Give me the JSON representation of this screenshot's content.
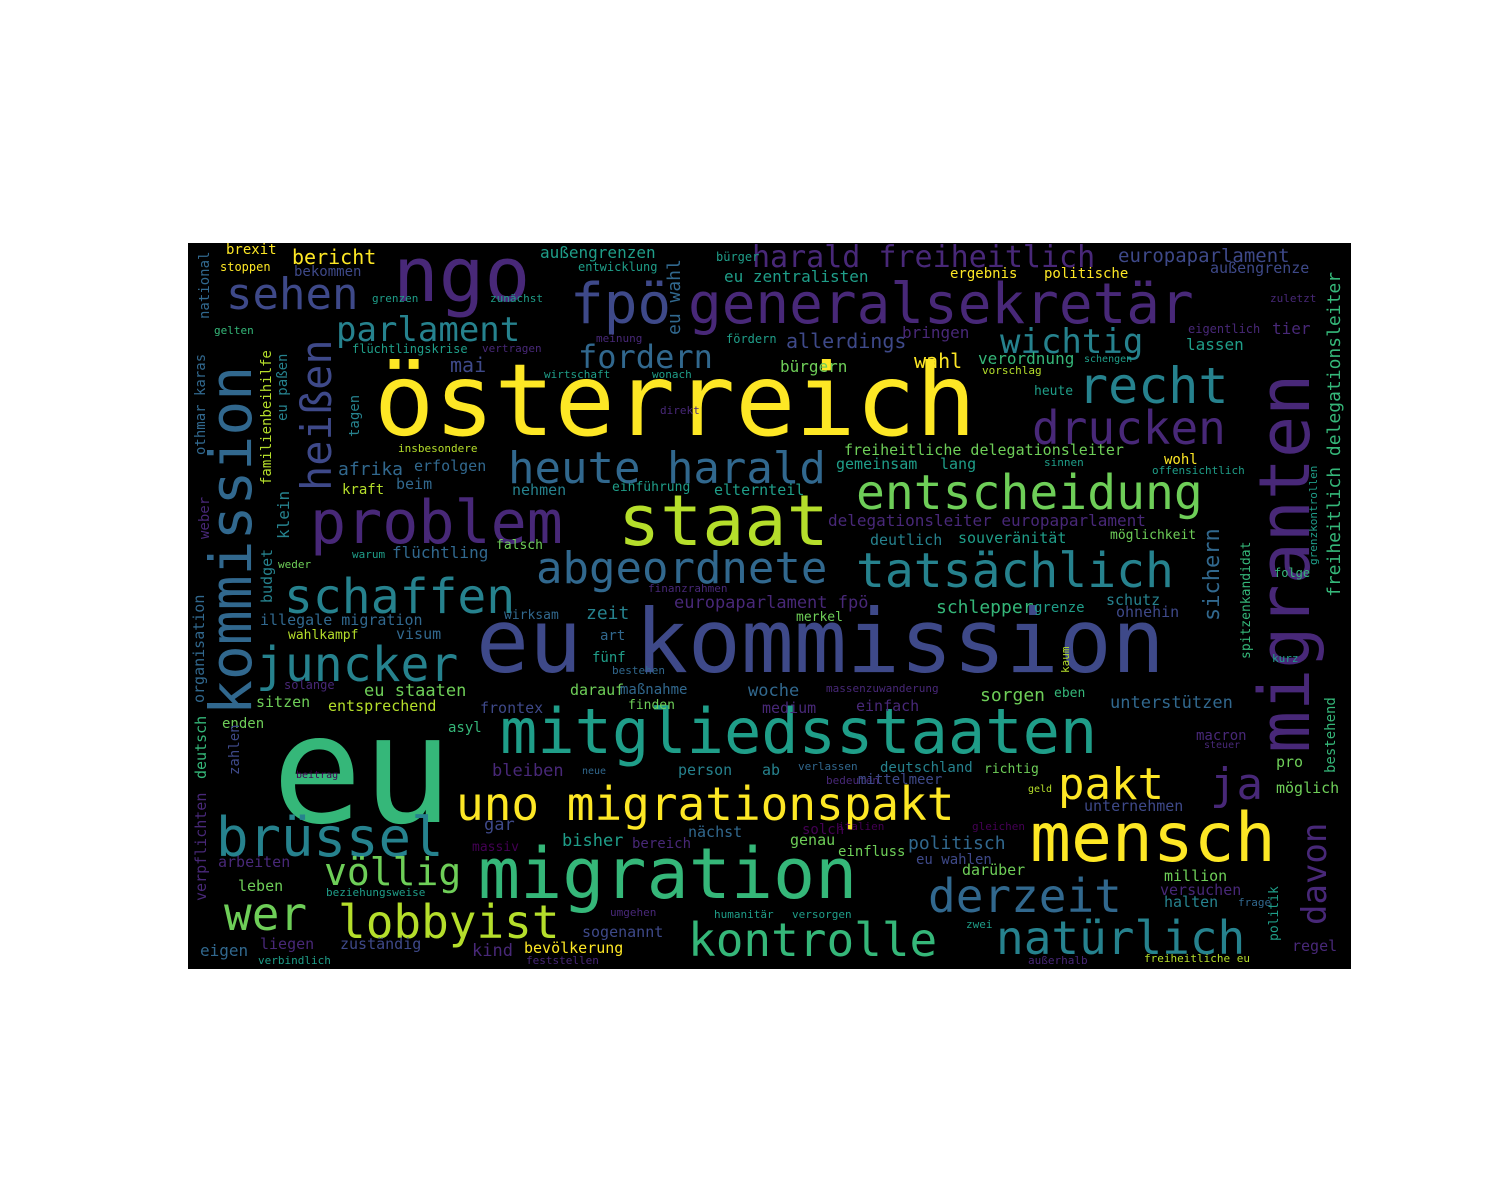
{
  "palette": {
    "yellow": "#fde725",
    "lime": "#b5de2b",
    "green": "#6ece58",
    "mint": "#35b779",
    "teal": "#1f9e89",
    "blue": "#26828e",
    "slate": "#31688e",
    "indigo": "#3e4989",
    "violet": "#482878",
    "purple": "#440154"
  },
  "words": [
    {
      "text": "österreich",
      "color": "yellow"
    },
    {
      "text": "eu kommission",
      "color": "indigo"
    },
    {
      "text": "eu",
      "color": "mint"
    },
    {
      "text": "migranten",
      "color": "violet"
    },
    {
      "text": "kommission",
      "color": "slate"
    },
    {
      "text": "staat",
      "color": "lime"
    },
    {
      "text": "migration",
      "color": "mint"
    },
    {
      "text": "mensch",
      "color": "yellow"
    },
    {
      "text": "ngo",
      "color": "violet"
    },
    {
      "text": "problem",
      "color": "violet"
    },
    {
      "text": "mitgliedsstaaten",
      "color": "teal"
    },
    {
      "text": "generalsekretär",
      "color": "violet"
    },
    {
      "text": "fpö",
      "color": "indigo"
    },
    {
      "text": "entscheidung",
      "color": "green"
    },
    {
      "text": "uno migrationspakt",
      "color": "yellow"
    },
    {
      "text": "brüssel",
      "color": "blue"
    },
    {
      "text": "tatsächlich",
      "color": "blue"
    },
    {
      "text": "abgeordnete",
      "color": "slate"
    },
    {
      "text": "heute harald",
      "color": "slate"
    },
    {
      "text": "schaffen",
      "color": "blue"
    },
    {
      "text": "juncker",
      "color": "blue"
    },
    {
      "text": "kontrolle",
      "color": "mint"
    },
    {
      "text": "natürlich",
      "color": "blue"
    },
    {
      "text": "derzeit",
      "color": "slate"
    },
    {
      "text": "wer",
      "color": "green"
    },
    {
      "text": "lobbyist",
      "color": "lime"
    },
    {
      "text": "recht",
      "color": "blue"
    },
    {
      "text": "drucken",
      "color": "violet"
    },
    {
      "text": "pakt",
      "color": "yellow"
    },
    {
      "text": "sehen",
      "color": "indigo"
    },
    {
      "text": "heißen",
      "color": "indigo"
    },
    {
      "text": "harald freiheitlich",
      "color": "violet"
    },
    {
      "text": "ja",
      "color": "violet"
    },
    {
      "text": "völlig",
      "color": "green"
    },
    {
      "text": "davon",
      "color": "violet"
    },
    {
      "text": "parlament",
      "color": "blue"
    },
    {
      "text": "fordern",
      "color": "slate"
    },
    {
      "text": "wichtig",
      "color": "blue"
    },
    {
      "text": "europaparlament",
      "color": "indigo"
    },
    {
      "text": "freiheitlich delegationsleiter",
      "color": "mint"
    },
    {
      "text": "bericht",
      "color": "yellow"
    },
    {
      "text": "brexit",
      "color": "yellow"
    },
    {
      "text": "stoppen",
      "color": "yellow"
    },
    {
      "text": "bekommen",
      "color": "indigo"
    },
    {
      "text": "national",
      "color": "slate"
    },
    {
      "text": "außengrenzen",
      "color": "teal"
    },
    {
      "text": "entwicklung",
      "color": "teal"
    },
    {
      "text": "bürger",
      "color": "teal"
    },
    {
      "text": "eu zentralisten",
      "color": "teal"
    },
    {
      "text": "ergebnis",
      "color": "yellow"
    },
    {
      "text": "politische",
      "color": "yellow"
    },
    {
      "text": "außengrenze",
      "color": "indigo"
    },
    {
      "text": "eu wahl",
      "color": "slate"
    },
    {
      "text": "grenzen",
      "color": "teal"
    },
    {
      "text": "zunächst",
      "color": "teal"
    },
    {
      "text": "zuletzt",
      "color": "violet"
    },
    {
      "text": "gelten",
      "color": "mint"
    },
    {
      "text": "eu paßen",
      "color": "blue"
    },
    {
      "text": "familienbeihilfe",
      "color": "lime"
    },
    {
      "text": "flüchtlingskrise",
      "color": "teal"
    },
    {
      "text": "vertragen",
      "color": "violet"
    },
    {
      "text": "meinung",
      "color": "violet"
    },
    {
      "text": "fördern",
      "color": "teal"
    },
    {
      "text": "allerdings",
      "color": "indigo"
    },
    {
      "text": "bringen",
      "color": "violet"
    },
    {
      "text": "eigentlich",
      "color": "violet"
    },
    {
      "text": "tier",
      "color": "violet"
    },
    {
      "text": "lassen",
      "color": "teal"
    },
    {
      "text": "wahl",
      "color": "yellow"
    },
    {
      "text": "verordnung",
      "color": "mint"
    },
    {
      "text": "schengen",
      "color": "teal"
    },
    {
      "text": "vorschlag",
      "color": "lime"
    },
    {
      "text": "mai",
      "color": "indigo"
    },
    {
      "text": "wirtschaft",
      "color": "teal"
    },
    {
      "text": "wonach",
      "color": "teal"
    },
    {
      "text": "bürgern",
      "color": "green"
    },
    {
      "text": "othmar karas",
      "color": "slate"
    },
    {
      "text": "tagen",
      "color": "blue"
    },
    {
      "text": "heute",
      "color": "teal"
    },
    {
      "text": "direkt",
      "color": "violet"
    },
    {
      "text": "insbesondere",
      "color": "lime"
    },
    {
      "text": "freiheitliche delegationsleiter",
      "color": "green"
    },
    {
      "text": "afrika",
      "color": "slate"
    },
    {
      "text": "erfolgen",
      "color": "slate"
    },
    {
      "text": "gemeinsam",
      "color": "teal"
    },
    {
      "text": "lang",
      "color": "teal"
    },
    {
      "text": "sinnen",
      "color": "teal"
    },
    {
      "text": "wohl",
      "color": "yellow"
    },
    {
      "text": "offensichtlich",
      "color": "teal"
    },
    {
      "text": "kraft",
      "color": "lime"
    },
    {
      "text": "beim",
      "color": "slate"
    },
    {
      "text": "nehmen",
      "color": "blue"
    },
    {
      "text": "einführung",
      "color": "teal"
    },
    {
      "text": "elternteil",
      "color": "teal"
    },
    {
      "text": "klein",
      "color": "blue"
    },
    {
      "text": "weber",
      "color": "violet"
    },
    {
      "text": "delegationsleiter europaparlament",
      "color": "violet"
    },
    {
      "text": "deutlich",
      "color": "blue"
    },
    {
      "text": "souveränität",
      "color": "teal"
    },
    {
      "text": "möglichkeit",
      "color": "green"
    },
    {
      "text": "grenzkontrollen",
      "color": "teal"
    },
    {
      "text": "budget",
      "color": "blue"
    },
    {
      "text": "flüchtling",
      "color": "slate"
    },
    {
      "text": "warum",
      "color": "teal"
    },
    {
      "text": "falsch",
      "color": "green"
    },
    {
      "text": "weder",
      "color": "green"
    },
    {
      "text": "sichern",
      "color": "slate"
    },
    {
      "text": "spitzenkandidat",
      "color": "mint"
    },
    {
      "text": "folge",
      "color": "mint"
    },
    {
      "text": "finanzrahmen",
      "color": "violet"
    },
    {
      "text": "europaparlament fpö",
      "color": "violet"
    },
    {
      "text": "schlepper",
      "color": "mint"
    },
    {
      "text": "grenze",
      "color": "teal"
    },
    {
      "text": "schutz",
      "color": "blue"
    },
    {
      "text": "ohnehin",
      "color": "indigo"
    },
    {
      "text": "illegale migration",
      "color": "slate"
    },
    {
      "text": "wirksam",
      "color": "slate"
    },
    {
      "text": "zeit",
      "color": "blue"
    },
    {
      "text": "merkel",
      "color": "green"
    },
    {
      "text": "organisation",
      "color": "slate"
    },
    {
      "text": "wahlkampf",
      "color": "lime"
    },
    {
      "text": "visum",
      "color": "slate"
    },
    {
      "text": "art",
      "color": "slate"
    },
    {
      "text": "kaum",
      "color": "lime"
    },
    {
      "text": "fünf",
      "color": "teal"
    },
    {
      "text": "bestehen",
      "color": "slate"
    },
    {
      "text": "kurz",
      "color": "teal"
    },
    {
      "text": "solange",
      "color": "violet"
    },
    {
      "text": "eu staaten",
      "color": "green"
    },
    {
      "text": "darauf",
      "color": "green"
    },
    {
      "text": "maßnahme",
      "color": "slate"
    },
    {
      "text": "woche",
      "color": "slate"
    },
    {
      "text": "massenzuwanderung",
      "color": "violet"
    },
    {
      "text": "sorgen",
      "color": "green"
    },
    {
      "text": "eben",
      "color": "mint"
    },
    {
      "text": "bestehend",
      "color": "mint"
    },
    {
      "text": "sitzen",
      "color": "green"
    },
    {
      "text": "entsprechend",
      "color": "lime"
    },
    {
      "text": "frontex",
      "color": "indigo"
    },
    {
      "text": "finden",
      "color": "green"
    },
    {
      "text": "medium",
      "color": "violet"
    },
    {
      "text": "einfach",
      "color": "violet"
    },
    {
      "text": "unterstützen",
      "color": "slate"
    },
    {
      "text": "macron",
      "color": "violet"
    },
    {
      "text": "deutsch",
      "color": "mint"
    },
    {
      "text": "enden",
      "color": "green"
    },
    {
      "text": "asyl",
      "color": "mint"
    },
    {
      "text": "steuer",
      "color": "violet"
    },
    {
      "text": "zahlen",
      "color": "indigo"
    },
    {
      "text": "bleiben",
      "color": "violet"
    },
    {
      "text": "neue",
      "color": "slate"
    },
    {
      "text": "person",
      "color": "blue"
    },
    {
      "text": "ab",
      "color": "blue"
    },
    {
      "text": "verlassen",
      "color": "slate"
    },
    {
      "text": "deutschland",
      "color": "blue"
    },
    {
      "text": "richtig",
      "color": "green"
    },
    {
      "text": "pro",
      "color": "green"
    },
    {
      "text": "beitrag",
      "color": "purple"
    },
    {
      "text": "bedeuten",
      "color": "violet"
    },
    {
      "text": "mittelmeer",
      "color": "indigo"
    },
    {
      "text": "geld",
      "color": "lime"
    },
    {
      "text": "möglich",
      "color": "green"
    },
    {
      "text": "unternehmen",
      "color": "indigo"
    },
    {
      "text": "gar",
      "color": "indigo"
    },
    {
      "text": "nächst",
      "color": "slate"
    },
    {
      "text": "solch",
      "color": "purple"
    },
    {
      "text": "italien",
      "color": "purple"
    },
    {
      "text": "gleichen",
      "color": "purple"
    },
    {
      "text": "verpflichten",
      "color": "violet"
    },
    {
      "text": "bisher",
      "color": "teal"
    },
    {
      "text": "bereich",
      "color": "violet"
    },
    {
      "text": "genau",
      "color": "green"
    },
    {
      "text": "politisch",
      "color": "slate"
    },
    {
      "text": "massiv",
      "color": "purple"
    },
    {
      "text": "einfluss",
      "color": "green"
    },
    {
      "text": "eu wahlen",
      "color": "indigo"
    },
    {
      "text": "arbeiten",
      "color": "violet"
    },
    {
      "text": "darüber",
      "color": "green"
    },
    {
      "text": "million",
      "color": "green"
    },
    {
      "text": "leben",
      "color": "green"
    },
    {
      "text": "beziehungsweise",
      "color": "teal"
    },
    {
      "text": "versuchen",
      "color": "violet"
    },
    {
      "text": "politik",
      "color": "teal"
    },
    {
      "text": "halten",
      "color": "blue"
    },
    {
      "text": "frage",
      "color": "slate"
    },
    {
      "text": "umgehen",
      "color": "violet"
    },
    {
      "text": "humanitär",
      "color": "teal"
    },
    {
      "text": "versorgen",
      "color": "teal"
    },
    {
      "text": "zwei",
      "color": "teal"
    },
    {
      "text": "sogenannt",
      "color": "indigo"
    },
    {
      "text": "liegen",
      "color": "violet"
    },
    {
      "text": "zuständig",
      "color": "indigo"
    },
    {
      "text": "kind",
      "color": "violet"
    },
    {
      "text": "bevölkerung",
      "color": "yellow"
    },
    {
      "text": "eigen",
      "color": "slate"
    },
    {
      "text": "regel",
      "color": "violet"
    },
    {
      "text": "verbindlich",
      "color": "teal"
    },
    {
      "text": "feststellen",
      "color": "violet"
    },
    {
      "text": "außerhalb",
      "color": "violet"
    },
    {
      "text": "freiheitliche eu",
      "color": "lime"
    }
  ]
}
